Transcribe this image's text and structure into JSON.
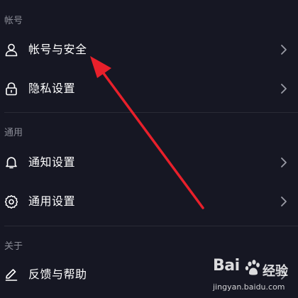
{
  "sections": {
    "account": {
      "label": "帐号",
      "items": [
        {
          "label": "帐号与安全",
          "icon": "user-icon"
        },
        {
          "label": "隐私设置",
          "icon": "lock-icon"
        }
      ]
    },
    "general": {
      "label": "通用",
      "items": [
        {
          "label": "通知设置",
          "icon": "bell-icon"
        },
        {
          "label": "通用设置",
          "icon": "gear-icon"
        }
      ]
    },
    "about": {
      "label": "关于",
      "items": [
        {
          "label": "反馈与帮助",
          "icon": "pen-icon"
        }
      ]
    }
  },
  "annotation": {
    "arrow_color": "#e8202b"
  },
  "watermark": {
    "brand_prefix": "Bai",
    "brand_suffix": "经验",
    "url": "jingyan.baidu.com"
  },
  "colors": {
    "background": "#161723",
    "section_text": "#8b8d97",
    "item_text": "#ffffff",
    "divider": "#2a2b36"
  }
}
